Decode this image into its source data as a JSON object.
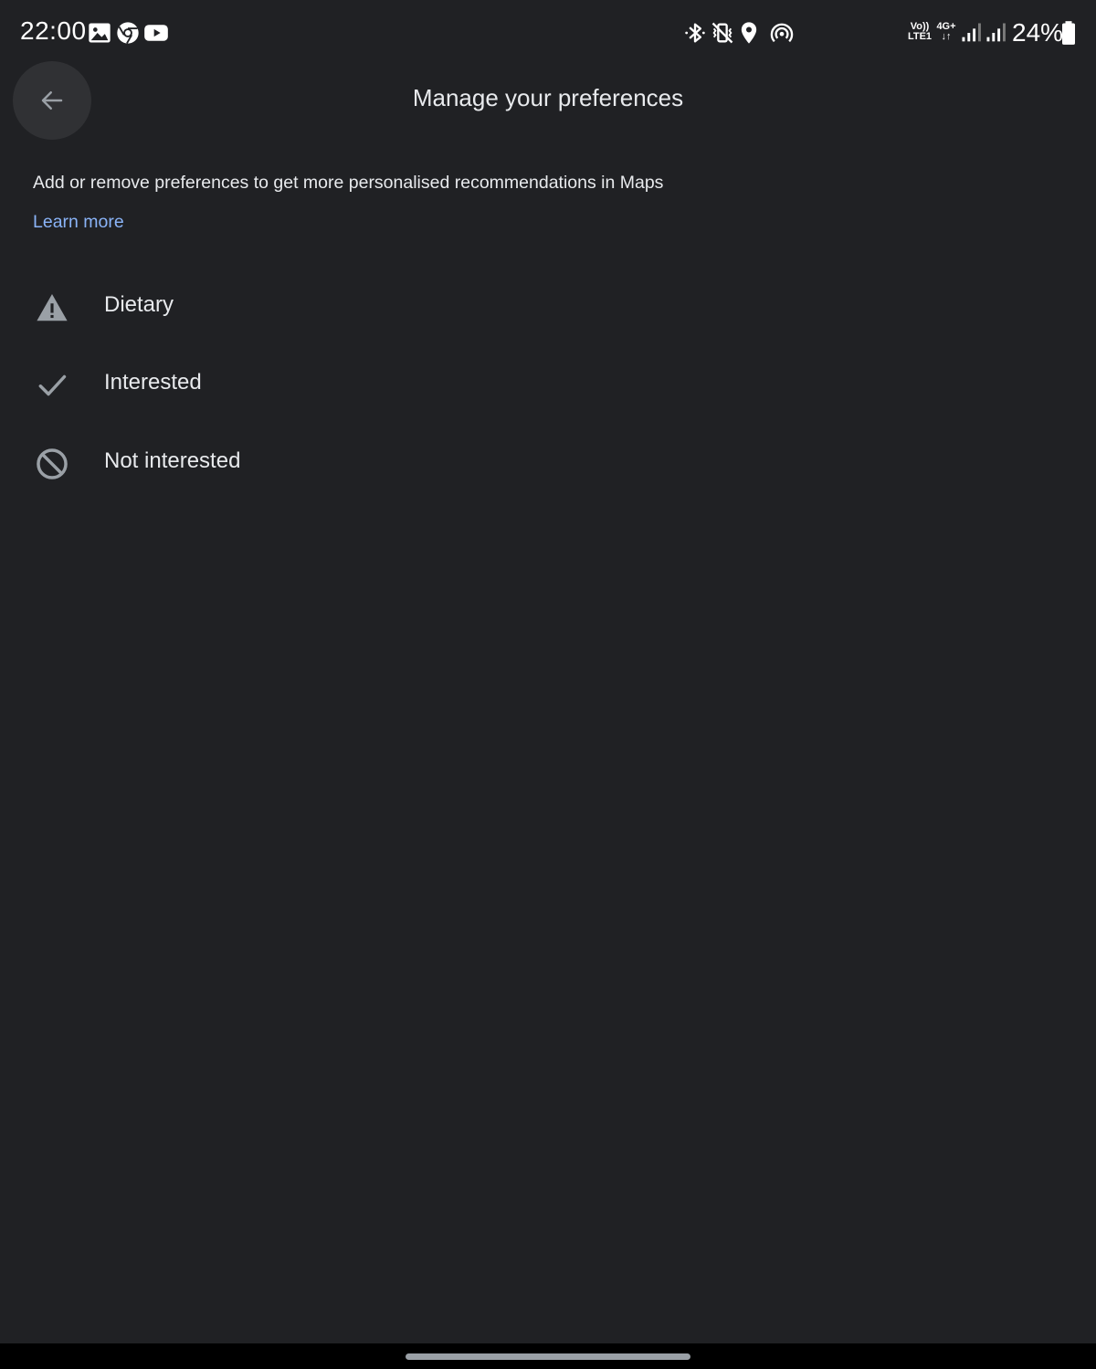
{
  "status_bar": {
    "time": "22:00",
    "notification_icons": [
      "gallery-icon",
      "chrome-icon",
      "youtube-icon"
    ],
    "system_icons": [
      "bluetooth-icon",
      "vibrate-icon",
      "location-icon",
      "hotspot-icon"
    ],
    "network": {
      "volte_top": "Vo))",
      "volte_bottom": "LTE1",
      "data_top": "4G+",
      "data_bottom": "↓↑"
    },
    "battery_percent": "24%"
  },
  "header": {
    "title": "Manage your preferences",
    "back_icon": "arrow-back-icon"
  },
  "intro": {
    "description": "Add or remove preferences to get more personalised recommendations in Maps",
    "learn_more": "Learn more"
  },
  "preferences": [
    {
      "label": "Dietary",
      "icon": "warning-icon"
    },
    {
      "label": "Interested",
      "icon": "checkmark-icon"
    },
    {
      "label": "Not interested",
      "icon": "block-icon"
    }
  ],
  "colors": {
    "background": "#202124",
    "text": "#e8eaed",
    "link": "#8ab4f8",
    "icon": "#9aa0a6",
    "back_button_bg": "#303134"
  }
}
